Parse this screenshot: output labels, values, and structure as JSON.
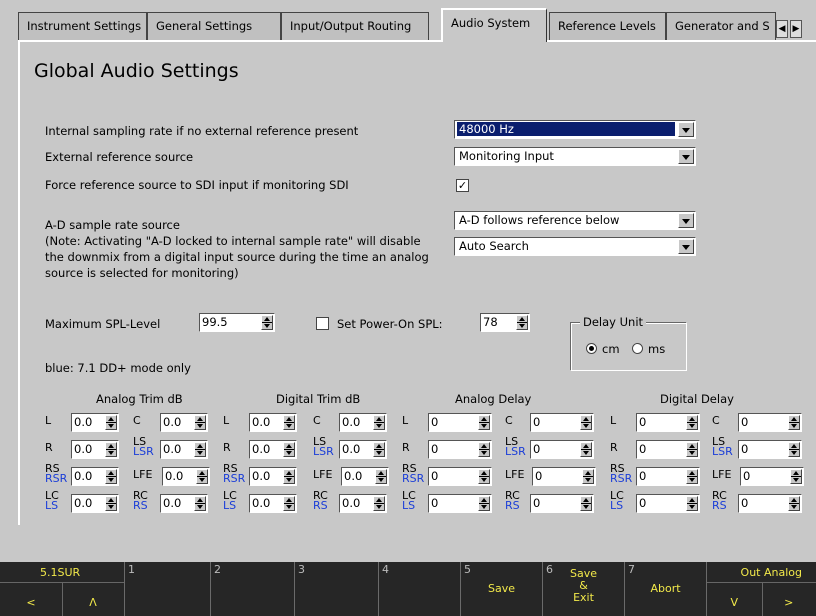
{
  "tabs": [
    {
      "label": "Instrument Settings"
    },
    {
      "label": "General Settings"
    },
    {
      "label": "Input/Output Routing"
    },
    {
      "label": "Audio System"
    },
    {
      "label": "Reference Levels"
    },
    {
      "label": "Generator and S"
    }
  ],
  "tab_nav": {
    "prev": "◀",
    "next": "▶"
  },
  "title": "Global Audio Settings",
  "sampling": {
    "label": "Internal sampling rate if no external reference present",
    "value": "48000 Hz"
  },
  "ext_ref": {
    "label": "External reference source",
    "value": "Monitoring Input"
  },
  "force_ref": {
    "label": "Force reference source to SDI input if monitoring SDI",
    "checked": "✓"
  },
  "ad": {
    "label": "A-D sample rate source",
    "note1": "(Note: Activating \"A-D locked to internal sample rate\" will disable",
    "note2": "the downmix from a digital input source during the time an analog",
    "note3": "source is selected for monitoring)",
    "value1": "A-D follows reference below",
    "value2": "Auto Search"
  },
  "spl": {
    "label": "Maximum SPL-Level",
    "value": "99.5"
  },
  "poweron": {
    "label": "Set Power-On SPL:",
    "value": "78"
  },
  "delay_unit": {
    "legend": "Delay Unit",
    "opt1": "cm",
    "opt2": "ms",
    "selected": "cm"
  },
  "blue_note": "blue: 7.1 DD+ mode only",
  "sections": {
    "analog_trim": "Analog Trim dB",
    "digital_trim": "Digital Trim dB",
    "analog_delay": "Analog Delay",
    "digital_delay": "Digital Delay"
  },
  "channels": {
    "L": "L",
    "R": "R",
    "RS": "RS",
    "RSR": "RSR",
    "LC": "LC",
    "LS": "LS",
    "C": "C",
    "LSR": "LSR",
    "LFE": "LFE",
    "RC": "RC"
  },
  "trim_value": "0.0",
  "delay_value": "0",
  "footer": {
    "k0_top": "5.1SUR",
    "k0_left": "<",
    "k0_right": "Λ",
    "k1": "1",
    "k2": "2",
    "k3": "3",
    "k4": "4",
    "k5_num": "5",
    "k5": "Save",
    "k6_num": "6",
    "k6_l1": "Save",
    "k6_l2": "&",
    "k6_l3": "Exit",
    "k7_num": "7",
    "k7": "Abort",
    "k8_top": "Out Analog",
    "k8_left": "V",
    "k8_right": ">"
  },
  "colors": {
    "footer_text": "#f2e94a",
    "selection": "#0a1e6e",
    "blue_label": "#1a3dd8"
  }
}
